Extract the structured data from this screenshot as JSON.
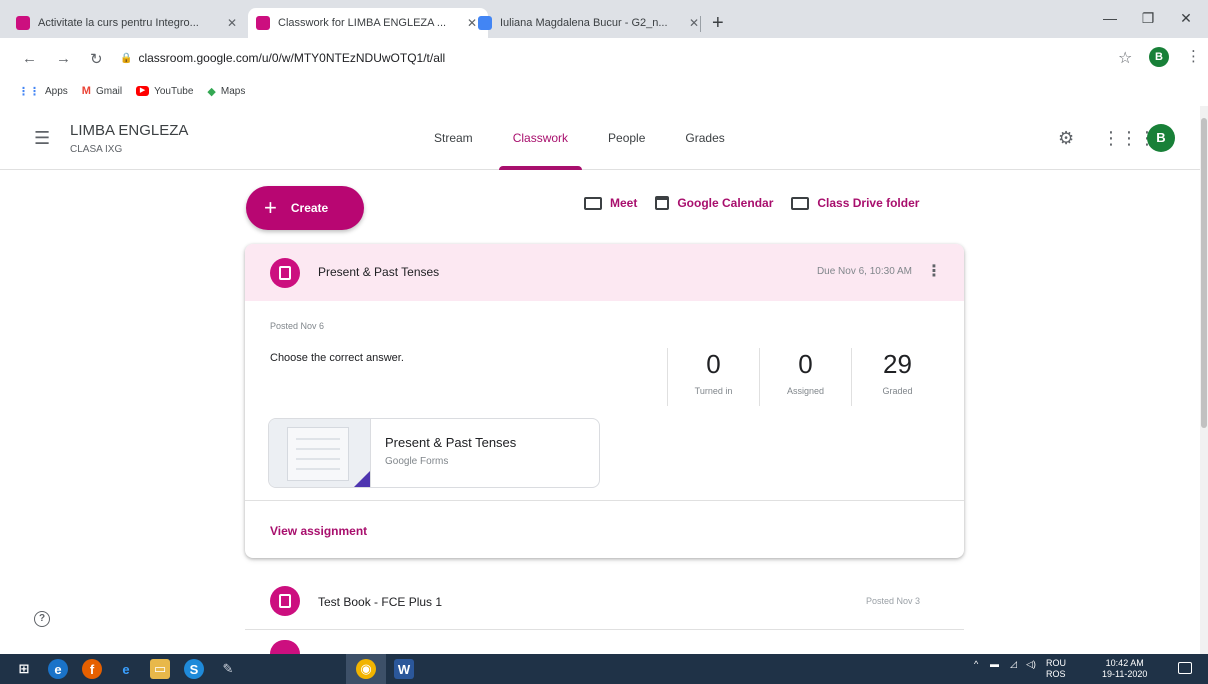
{
  "browser": {
    "tabs": [
      {
        "title": "Activitate la curs pentru Integro...",
        "icon": "classroom-icon",
        "active": false
      },
      {
        "title": "Classwork for LIMBA ENGLEZA ...",
        "icon": "classroom-icon",
        "active": true
      },
      {
        "title": "Iuliana Magdalena Bucur - G2_n...",
        "icon": "docs-icon",
        "active": false
      }
    ],
    "url": "classroom.google.com/u/0/w/MTY0NTEzNDUwOTQ1/t/all",
    "profile_initial": "B",
    "bookmarks": [
      {
        "label": "Apps",
        "icon": "apps-icon"
      },
      {
        "label": "Gmail",
        "icon": "gmail-icon"
      },
      {
        "label": "YouTube",
        "icon": "youtube-icon"
      },
      {
        "label": "Maps",
        "icon": "maps-icon"
      }
    ]
  },
  "header": {
    "class_name": "LIMBA ENGLEZA",
    "section": "CLASA IXG",
    "tabs": [
      "Stream",
      "Classwork",
      "People",
      "Grades"
    ],
    "active_tab": "Classwork",
    "avatar_initial": "B"
  },
  "main": {
    "create_label": "Create",
    "links": {
      "meet": "Meet",
      "calendar": "Google Calendar",
      "drive": "Class Drive folder"
    },
    "assignment": {
      "title": "Present & Past Tenses",
      "due": "Due Nov 6, 10:30 AM",
      "posted": "Posted Nov 6",
      "instructions": "Choose the correct answer.",
      "stats": [
        {
          "value": "0",
          "label": "Turned in"
        },
        {
          "value": "0",
          "label": "Assigned"
        },
        {
          "value": "29",
          "label": "Graded"
        }
      ],
      "attachment_title": "Present & Past Tenses",
      "attachment_type": "Google Forms",
      "view_label": "View assignment"
    },
    "next_item": {
      "title": "Test Book - FCE Plus 1",
      "posted": "Posted Nov 3"
    }
  },
  "taskbar": {
    "lang_top": "ROU",
    "lang_bottom": "ROS",
    "time": "10:42 AM",
    "date": "19-11-2020"
  },
  "colors": {
    "accent": "#a80f6d",
    "create_button": "#b80672",
    "card_header": "#fce8f2",
    "avatar": "#188038",
    "taskbar": "#1f3247"
  }
}
